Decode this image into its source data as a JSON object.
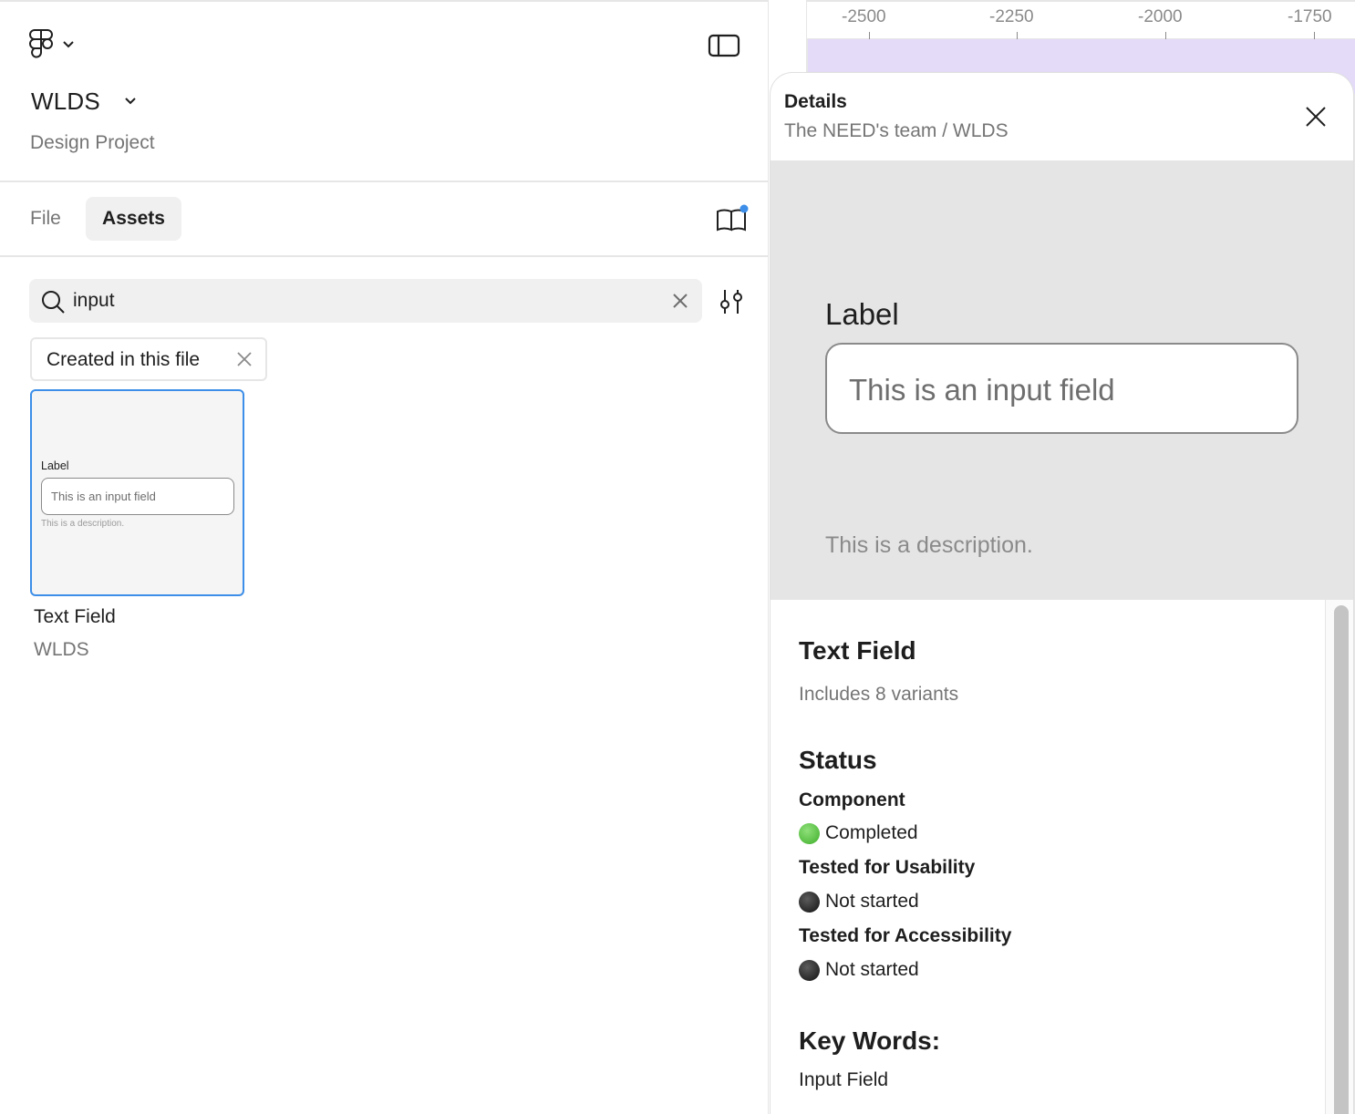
{
  "app": {
    "logo_icon": "figma-logo-icon",
    "logo_menu_icon": "chevron-down-icon",
    "sidebar_toggle_icon": "sidebar-toggle-icon"
  },
  "project": {
    "name": "WLDS",
    "type": "Design Project"
  },
  "tabs": [
    {
      "label": "File",
      "active": false
    },
    {
      "label": "Assets",
      "active": true
    }
  ],
  "library_icon": "book-open-icon",
  "library_badge_color": "#3c8ee8",
  "search": {
    "value": "input",
    "icon": "search-icon",
    "clear_icon": "close-icon",
    "filter_icon": "sliders-icon"
  },
  "filter_chip": {
    "label": "Created in this file"
  },
  "asset": {
    "preview": {
      "label": "Label",
      "placeholder": "This is an input field",
      "description": "This is a description."
    },
    "name": "Text Field",
    "library": "WLDS"
  },
  "ruler": {
    "ticks": [
      "-2500",
      "-2250",
      "-2000",
      "-1750"
    ]
  },
  "details": {
    "title": "Details",
    "path": "The NEED's team / WLDS",
    "preview": {
      "label": "Label",
      "placeholder": "This is an input field",
      "description": "This is a description."
    },
    "component_name": "Text Field",
    "variants": "Includes 8 variants",
    "status_heading": "Status",
    "statuses": [
      {
        "label": "Component",
        "value": "Completed",
        "color": "green"
      },
      {
        "label": "Tested for Usability",
        "value": "Not started",
        "color": "black"
      },
      {
        "label": "Tested for Accessibility",
        "value": "Not started",
        "color": "black"
      }
    ],
    "keywords_heading": "Key Words:",
    "keywords": "Input Field"
  },
  "colors": {
    "accent": "#3c8ee8",
    "frame_purple": "#e3dbf7",
    "status_green": "#3fae2a",
    "status_black": "#111111"
  }
}
